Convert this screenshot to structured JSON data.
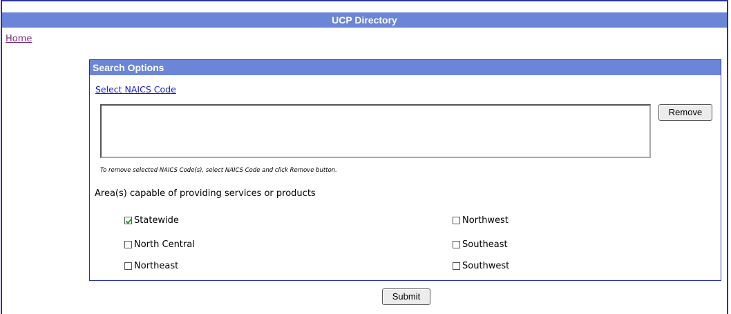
{
  "header": {
    "title": "UCP Directory"
  },
  "nav": {
    "home_label": "Home"
  },
  "search_options": {
    "title": "Search Options",
    "select_naics_label": "Select NAICS Code",
    "naics_selected": [],
    "remove_label": "Remove",
    "hint": "To remove selected NAICS Code(s), select NAICS Code and click Remove button.",
    "area_label": "Area(s) capable of providing services or products",
    "areas": [
      {
        "label": "Statewide",
        "checked": true
      },
      {
        "label": "North Central",
        "checked": false
      },
      {
        "label": "Northeast",
        "checked": false
      },
      {
        "label": "Northwest",
        "checked": false
      },
      {
        "label": "Southeast",
        "checked": false
      },
      {
        "label": "Southwest",
        "checked": false
      }
    ]
  },
  "submit_label": "Submit",
  "colors": {
    "header_bg": "#6b85d8",
    "border": "#2a30a8",
    "link": "#1a1ad0",
    "visited_link": "#7a2a7a",
    "check": "#2e9a2e"
  }
}
